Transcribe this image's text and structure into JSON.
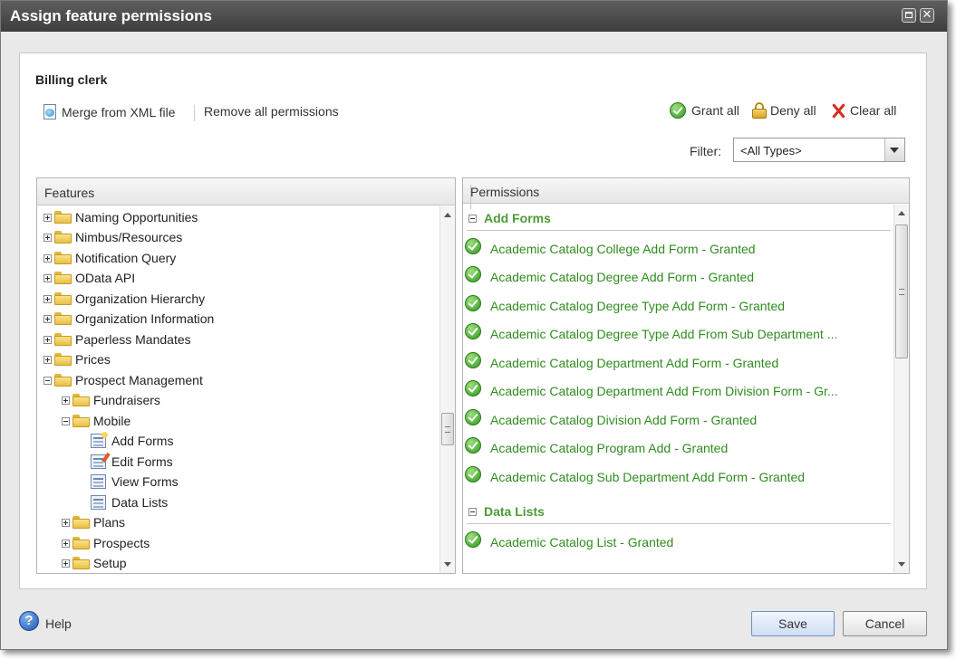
{
  "window": {
    "title": "Assign feature permissions"
  },
  "role_name": "Billing clerk",
  "toolbar": {
    "merge_label": "Merge from XML file",
    "remove_all_label": "Remove all permissions",
    "grant_all_label": "Grant all",
    "deny_all_label": "Deny all",
    "clear_all_label": "Clear all"
  },
  "filter": {
    "label": "Filter:",
    "value": "<All Types>"
  },
  "features": {
    "header": "Features",
    "items": [
      {
        "label": "Naming Opportunities",
        "icon": "folder-icon",
        "expander": "plus"
      },
      {
        "label": "Nimbus/Resources",
        "icon": "folder-icon",
        "expander": "plus"
      },
      {
        "label": "Notification Query",
        "icon": "folder-icon",
        "expander": "plus"
      },
      {
        "label": "OData API",
        "icon": "folder-icon",
        "expander": "plus"
      },
      {
        "label": "Organization Hierarchy",
        "icon": "folder-icon",
        "expander": "plus"
      },
      {
        "label": "Organization Information",
        "icon": "folder-icon",
        "expander": "plus"
      },
      {
        "label": "Paperless Mandates",
        "icon": "folder-icon",
        "expander": "plus"
      },
      {
        "label": "Prices",
        "icon": "folder-icon",
        "expander": "plus"
      },
      {
        "label": "Prospect Management",
        "icon": "folder-icon",
        "expander": "minus"
      },
      {
        "label": "Fundraisers",
        "icon": "folder-icon",
        "expander": "plus"
      },
      {
        "label": "Mobile",
        "icon": "folder-icon",
        "expander": "minus"
      },
      {
        "label": "Add Forms",
        "icon": "add-form-icon",
        "expander": "none"
      },
      {
        "label": "Edit Forms",
        "icon": "edit-form-icon",
        "expander": "none"
      },
      {
        "label": "View Forms",
        "icon": "view-form-icon",
        "expander": "none"
      },
      {
        "label": "Data Lists",
        "icon": "data-list-icon",
        "expander": "none"
      },
      {
        "label": "Plans",
        "icon": "folder-icon",
        "expander": "plus"
      },
      {
        "label": "Prospects",
        "icon": "folder-icon",
        "expander": "plus"
      },
      {
        "label": "Setup",
        "icon": "folder-icon",
        "expander": "plus"
      }
    ]
  },
  "permissions": {
    "header": "Permissions",
    "groups": [
      {
        "title": "Add Forms",
        "items": [
          "Academic Catalog College Add Form - Granted",
          "Academic Catalog Degree Add Form - Granted",
          "Academic Catalog Degree Type Add Form - Granted",
          "Academic Catalog Degree Type Add From Sub Department ...",
          "Academic Catalog Department Add Form - Granted",
          "Academic Catalog Department Add From Division Form - Gr...",
          "Academic Catalog Division Add Form - Granted",
          "Academic Catalog Program Add - Granted",
          "Academic Catalog Sub Department Add Form - Granted"
        ]
      },
      {
        "title": "Data Lists",
        "items": [
          "Academic Catalog List - Granted"
        ]
      }
    ]
  },
  "footer": {
    "help_label": "Help",
    "save_label": "Save",
    "cancel_label": "Cancel"
  },
  "colors": {
    "granted_text": "#2f8c1f",
    "group_header": "#4b9b34",
    "titlebar": "#4a4a4a"
  }
}
